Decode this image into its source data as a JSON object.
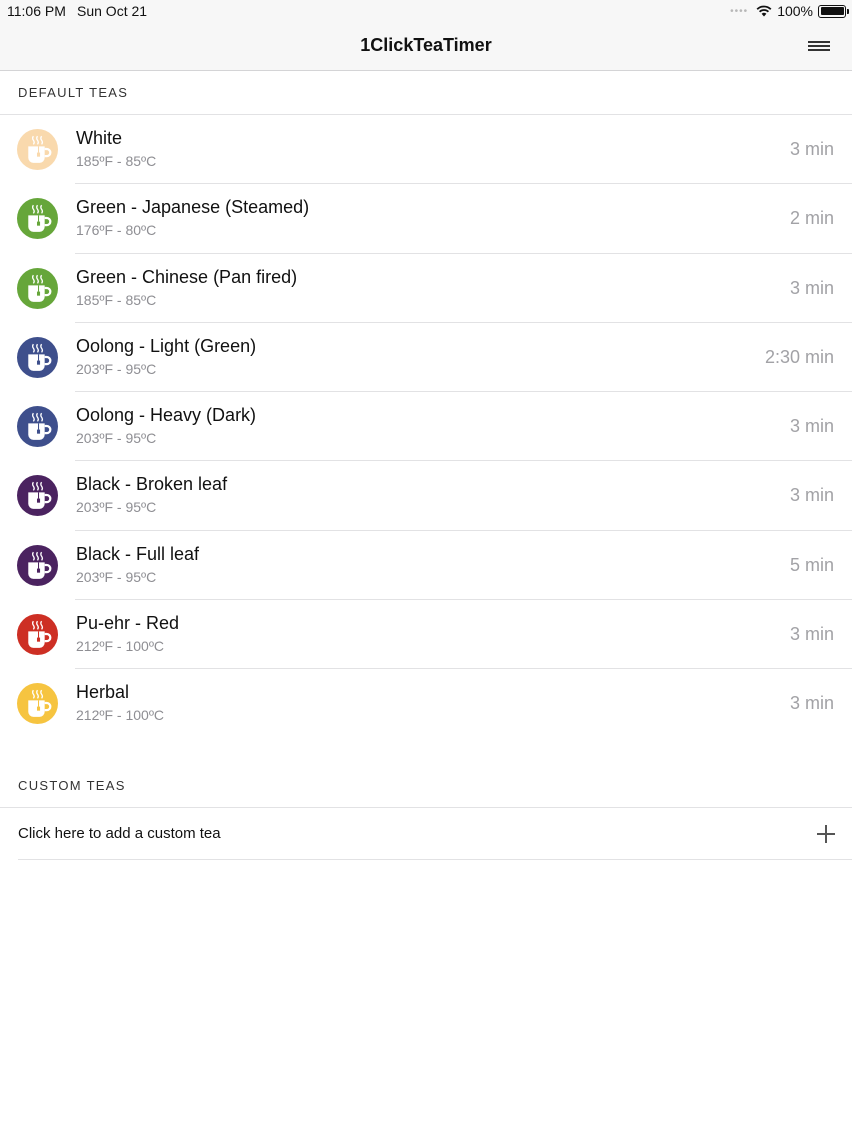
{
  "status_bar": {
    "time": "11:06 PM",
    "date": "Sun Oct 21",
    "signal": "••••",
    "battery": "100%"
  },
  "nav": {
    "title": "1ClickTeaTimer",
    "menu_icon": "hamburger-menu-icon"
  },
  "default_section": {
    "header": "DEFAULT TEAS",
    "teas": [
      {
        "name": "White",
        "temp": "185ºF - 85ºC",
        "time": "3 min",
        "color": "#f9d9ad",
        "icon": "tea-cup-icon"
      },
      {
        "name": "Green - Japanese (Steamed)",
        "temp": "176ºF - 80ºC",
        "time": "2 min",
        "color": "#66a63a",
        "icon": "tea-cup-icon"
      },
      {
        "name": "Green - Chinese (Pan fired)",
        "temp": "185ºF - 85ºC",
        "time": "3 min",
        "color": "#66a63a",
        "icon": "tea-cup-icon"
      },
      {
        "name": "Oolong - Light (Green)",
        "temp": "203ºF - 95ºC",
        "time": "2:30 min",
        "color": "#3e4f8c",
        "icon": "tea-cup-icon"
      },
      {
        "name": "Oolong - Heavy (Dark)",
        "temp": "203ºF - 95ºC",
        "time": "3 min",
        "color": "#3e4f8c",
        "icon": "tea-cup-icon"
      },
      {
        "name": "Black - Broken leaf",
        "temp": "203ºF - 95ºC",
        "time": "3 min",
        "color": "#4b2360",
        "icon": "tea-cup-icon"
      },
      {
        "name": "Black - Full leaf",
        "temp": "203ºF - 95ºC",
        "time": "5 min",
        "color": "#4b2360",
        "icon": "tea-cup-icon"
      },
      {
        "name": "Pu-ehr - Red",
        "temp": "212ºF - 100ºC",
        "time": "3 min",
        "color": "#cd2f24",
        "icon": "tea-cup-icon"
      },
      {
        "name": "Herbal",
        "temp": "212ºF - 100ºC",
        "time": "3 min",
        "color": "#f6c440",
        "icon": "tea-cup-icon"
      }
    ]
  },
  "custom_section": {
    "header": "CUSTOM TEAS",
    "add_label": "Click here to add a custom tea",
    "add_icon": "plus-icon"
  }
}
